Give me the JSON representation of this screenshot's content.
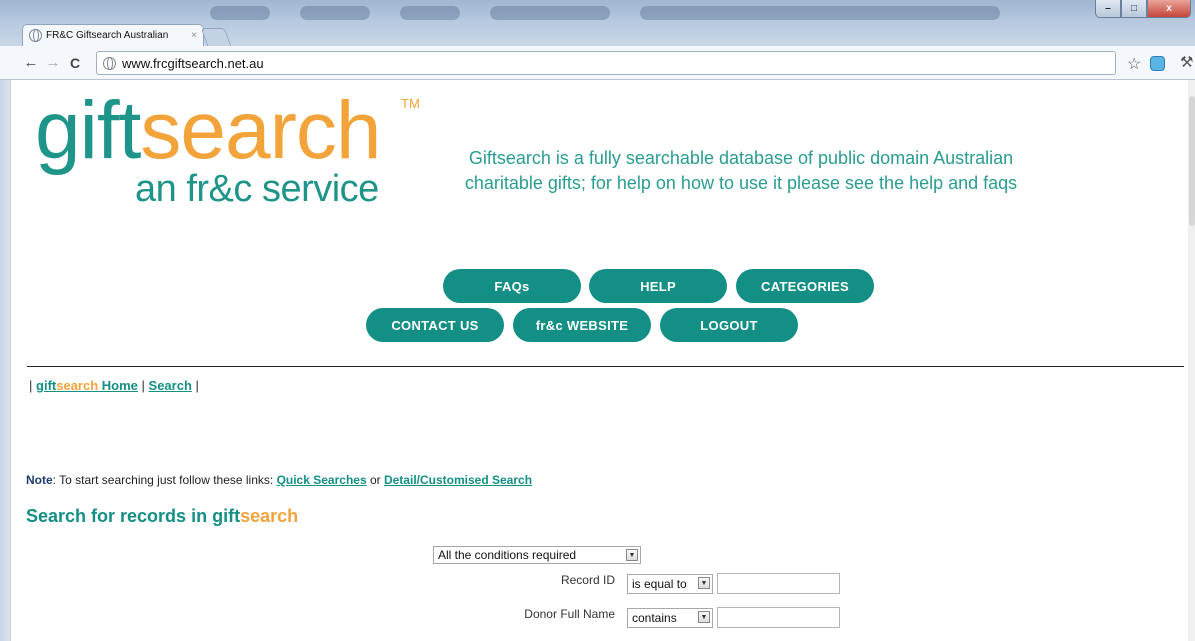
{
  "browser": {
    "tab_title": "FR&C Giftsearch Australian",
    "tab_close": "×",
    "url": "www.frcgiftsearch.net.au",
    "window_buttons": {
      "minimize": "–",
      "maximize": "□",
      "close": "x"
    }
  },
  "logo": {
    "gift": "gift",
    "search": "search",
    "tm": "TM",
    "subtitle": "an fr&c service"
  },
  "intro_text": "Giftsearch is a fully searchable database of public domain Australian charitable gifts; for help on how to use it please see the help and faqs",
  "nav_buttons": {
    "faqs": "FAQs",
    "help": "HELP",
    "categories": "CATEGORIES",
    "contact": "CONTACT US",
    "website": "fr&c WEBSITE",
    "logout": "LOGOUT"
  },
  "breadcrumb": {
    "sep": "|",
    "home_gift": "gift",
    "home_search": "search",
    "home_suffix": " Home",
    "search": "Search"
  },
  "note": {
    "label": "Note",
    "text": ": To start searching just follow these links: ",
    "link1": "Quick Searches",
    "or": " or ",
    "link2": "Detail/Customised Search"
  },
  "heading": {
    "prefix": "Search for records in ",
    "gift": "gift",
    "search": "search"
  },
  "search_form": {
    "conditions": "All the conditions required",
    "fields": [
      {
        "label": "Record ID",
        "operator": "is equal to",
        "value": ""
      },
      {
        "label": "Donor Full Name",
        "operator": "contains",
        "value": ""
      }
    ]
  },
  "icons": {
    "back": "back-arrow-icon",
    "forward": "forward-arrow-icon",
    "reload": "reload-icon",
    "star": "star-icon",
    "wrench": "wrench-icon",
    "dropdown": "chevron-down-icon"
  }
}
